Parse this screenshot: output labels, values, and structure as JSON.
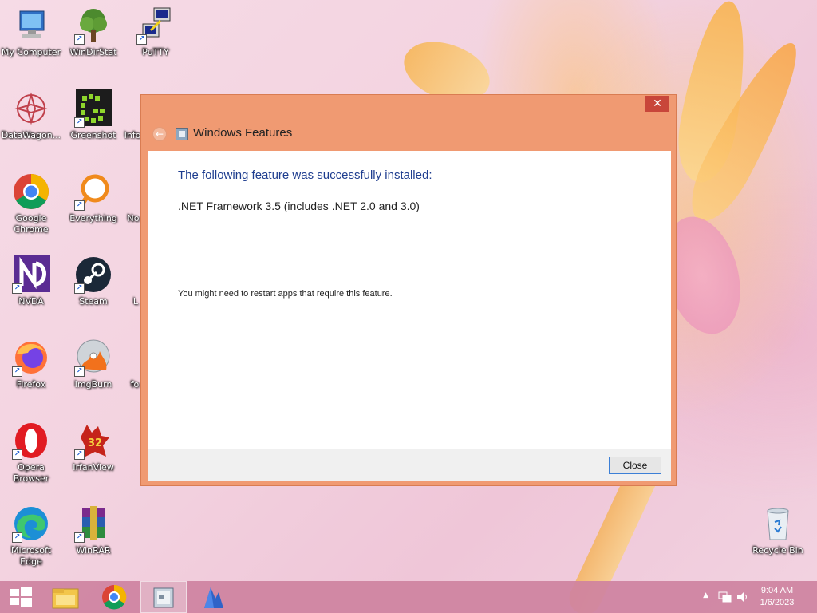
{
  "desktop": {
    "icons": [
      {
        "label": "My Computer"
      },
      {
        "label": "WinDirStat"
      },
      {
        "label": "PuTTY"
      },
      {
        "label": "DataWagon..."
      },
      {
        "label": "Greenshot"
      },
      {
        "label": "Info"
      },
      {
        "label": "Google Chrome"
      },
      {
        "label": "Everything"
      },
      {
        "label": "No"
      },
      {
        "label": "NVDA"
      },
      {
        "label": "Steam"
      },
      {
        "label": "L"
      },
      {
        "label": "Firefox"
      },
      {
        "label": "ImgBurn"
      },
      {
        "label": "fo"
      },
      {
        "label": "Opera Browser"
      },
      {
        "label": "IrfanView"
      },
      {
        "label": "Microsoft Edge"
      },
      {
        "label": "WinRAR"
      },
      {
        "label": "Recycle Bin"
      }
    ]
  },
  "dialog": {
    "title": "Windows Features",
    "close_glyph": "✕",
    "back_glyph": "←",
    "heading": "The following feature was successfully installed:",
    "feature": ".NET Framework 3.5 (includes .NET 2.0 and 3.0)",
    "note": "You might need to restart apps that require this feature.",
    "close_button": "Close",
    "accent_color": "#f09a72",
    "heading_color": "#1e3d8f"
  },
  "taskbar": {
    "items": [
      "start-icon",
      "file-explorer-icon",
      "chrome-icon",
      "windows-features-icon",
      "app-icon"
    ],
    "clock": {
      "time": "9:04 AM",
      "date": "1/6/2023"
    },
    "tray_icons": [
      "show-hidden-icons-icon",
      "network-icon",
      "volume-icon"
    ],
    "tray_chevron": "▲"
  }
}
